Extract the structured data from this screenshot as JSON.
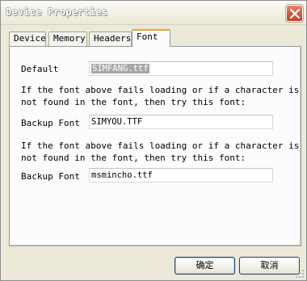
{
  "window": {
    "title": "Device Properties"
  },
  "tabs": [
    {
      "label": "Device",
      "active": false
    },
    {
      "label": "Memory",
      "active": false
    },
    {
      "label": "Headers",
      "active": false
    },
    {
      "label": "Font",
      "active": true
    }
  ],
  "font_tab": {
    "default_label": "Default",
    "default_value": "SIMFANG.ttf",
    "help_line1": "If the font above fails loading or if a character is",
    "help_line2": "not found in the font, then try this font:",
    "backup1_label": "Backup Font",
    "backup1_value": "SIMYOU.TTF",
    "help2_line1": "If the font above fails loading or if a character is",
    "help2_line2": "not found in the font, then try this font:",
    "backup2_label": "Backup Font",
    "backup2_value": "msmincho.ttf"
  },
  "buttons": {
    "ok": "确定",
    "cancel": "取消"
  },
  "colors": {
    "selection": "#a8a8a8",
    "active_tab_accent": "#e6a534",
    "close_button": "#d0563a"
  },
  "icons": {
    "close": "close-icon",
    "resize_grip": "resize-grip-icon"
  }
}
